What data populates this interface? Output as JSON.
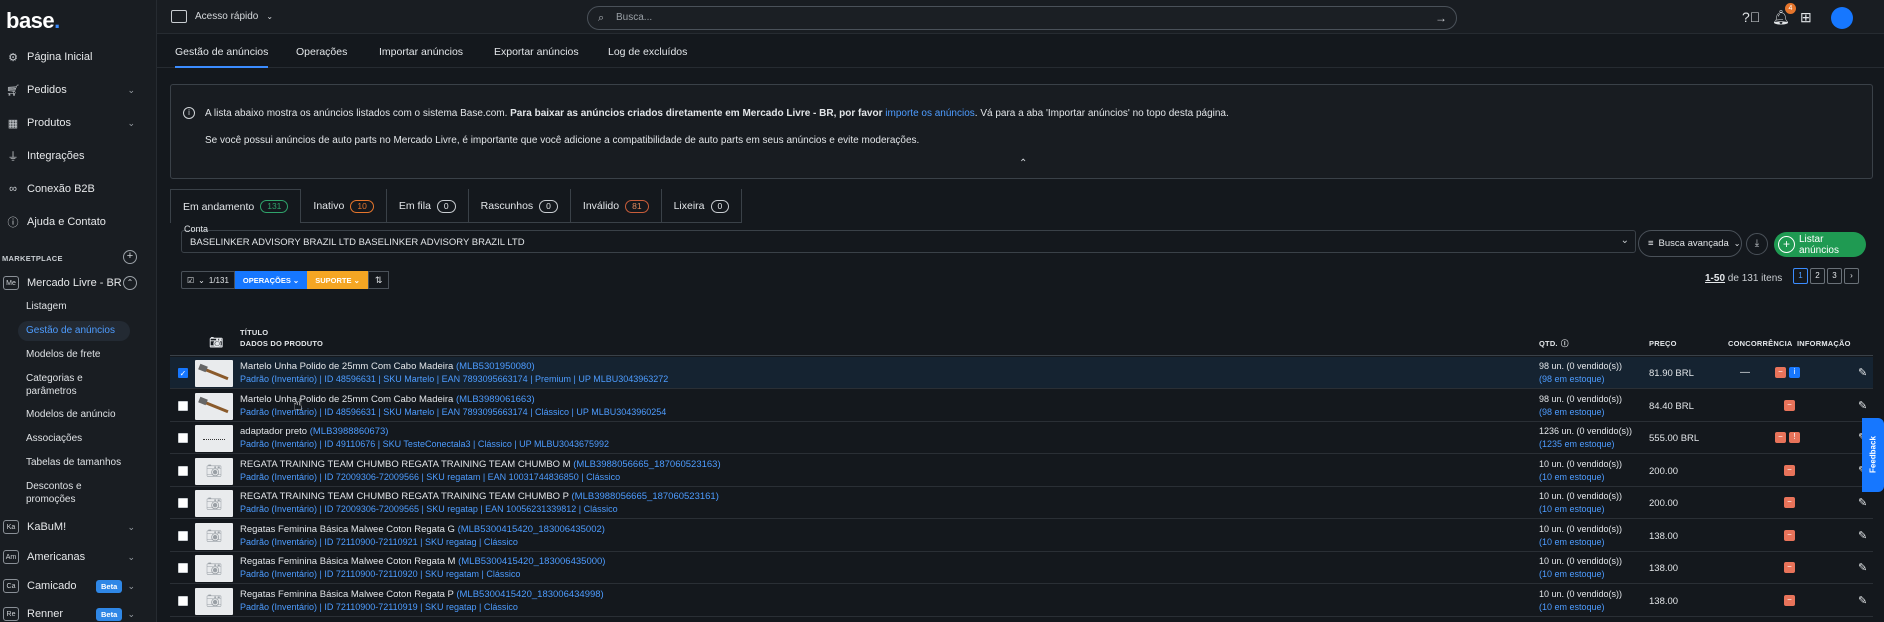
{
  "app": {
    "logo_text": "base",
    "logo_dot": "."
  },
  "sidebar": {
    "items": [
      {
        "label": "Página Inicial",
        "icon": "gear-icon"
      },
      {
        "label": "Pedidos",
        "icon": "cart-icon"
      },
      {
        "label": "Produtos",
        "icon": "box-icon"
      },
      {
        "label": "Integrações",
        "icon": "plug-icon"
      },
      {
        "label": "Conexão B2B",
        "icon": "link-icon"
      },
      {
        "label": "Ajuda e Contato",
        "icon": "help-icon"
      }
    ],
    "section_label": "MARKETPLACE",
    "marketplaces": [
      {
        "abbr": "Me",
        "label": "Mercado Livre - BR"
      },
      {
        "abbr": "Ka",
        "label": "KaBuM!"
      },
      {
        "abbr": "Am",
        "label": "Americanas"
      },
      {
        "abbr": "Ca",
        "label": "Camicado",
        "badge": "Beta"
      },
      {
        "abbr": "Re",
        "label": "Renner",
        "badge": "Beta"
      }
    ],
    "sub_items": [
      "Listagem",
      "Gestão de anúncios",
      "Modelos de frete",
      "Categorias e",
      "parâmetros",
      "Modelos de anúncio",
      "Associações",
      "Tabelas de tamanhos",
      "Descontos e",
      "promoções"
    ]
  },
  "topbar": {
    "quick_access": "Acesso rápido",
    "search_placeholder": "Busca...",
    "notif_count": "4"
  },
  "main_tabs": [
    "Gestão de anúncios",
    "Operações",
    "Importar anúncios",
    "Exportar anúncios",
    "Log de excluídos"
  ],
  "info": {
    "l1_a": "A lista abaixo mostra os anúncios listados com o sistema Base.com. ",
    "l1_b": "Para baixar as anúncios criados diretamente em Mercado Livre - BR, por favor ",
    "l1_link": "importe os anúncios",
    "l1_c": ". Vá para a aba 'Importar anúncios' no topo desta página.",
    "l2": "Se você possui anúncios de auto parts no Mercado Livre, é importante que você adicione a compatibilidade de auto parts em seus anúncios e evite moderações."
  },
  "status_tabs": [
    {
      "label": "Em andamento",
      "count": "131",
      "tone": "green"
    },
    {
      "label": "Inativo",
      "count": "10",
      "tone": "orange"
    },
    {
      "label": "Em fila",
      "count": "0",
      "tone": "plain"
    },
    {
      "label": "Rascunhos",
      "count": "0",
      "tone": "plain"
    },
    {
      "label": "Inválido",
      "count": "81",
      "tone": "red"
    },
    {
      "label": "Lixeira",
      "count": "0",
      "tone": "plain"
    }
  ],
  "conta": {
    "label": "Conta",
    "value": "BASELINKER ADVISORY BRAZIL LTD BASELINKER ADVISORY BRAZIL LTD"
  },
  "actions": {
    "busca": "Busca avançada",
    "listar": "Listar anúncios"
  },
  "toolbar": {
    "selected": "1/131",
    "ops": "OPERAÇÕES",
    "sup": "SUPORTE"
  },
  "pager": {
    "range": "1-50",
    "rest": " de 131 itens",
    "pages": [
      "1",
      "2",
      "3"
    ]
  },
  "table": {
    "headers": {
      "titulo": "TÍTULO",
      "dados": "DADOS DO PRODUTO",
      "qtd": "QTD.",
      "preco": "PREÇO",
      "concorrencia": "CONCORRÊNCIA",
      "informacao": "INFORMAÇÃO"
    },
    "rows": [
      {
        "title": "Martelo Unha Polido de 25mm Com Cabo Madeira ",
        "id": "(MLB5301950080)",
        "details": "Padrão (Inventário) | ID 48596631 | SKU Martelo | EAN 7893095663174 | Premium | UP MLBU3043963272",
        "qty": "98 un. (0 vendido(s))",
        "stock": "(98 em estoque)",
        "price": "81.90 BRL",
        "conc": "—",
        "thumb": "hammer",
        "checked": true,
        "blue": true
      },
      {
        "title": "Martelo Unha Polido de 25mm Com Cabo Madeira ",
        "id": "(MLB3989061663)",
        "details": "Padrão (Inventário) | ID 48596631 | SKU Martelo | EAN 7893095663174 | Clássico | UP MLBU3043960254",
        "qty": "98 un. (0 vendido(s))",
        "stock": "(98 em estoque)",
        "price": "84.40 BRL",
        "conc": "",
        "thumb": "hammer",
        "checked": false
      },
      {
        "title": "adaptador preto ",
        "id": "(MLB3988860673)",
        "details": "Padrão (Inventário) | ID 49110676 | SKU TesteConectala3 | Clássico | UP MLBU3043675992",
        "qty": "1236 un. (0 vendido(s))",
        "stock": "(1235 em estoque)",
        "price": "555.00 BRL",
        "conc": "",
        "thumb": "cable",
        "checked": false,
        "warn": true
      },
      {
        "title": "REGATA TRAINING TEAM CHUMBO REGATA TRAINING TEAM CHUMBO M ",
        "id": "(MLB3988056665_187060523163)",
        "details": "Padrão (Inventário) | ID 72009306-72009566 | SKU regatam | EAN 10031744836850 | Clássico",
        "qty": "10 un. (0 vendido(s))",
        "stock": "(10 em estoque)",
        "price": "200.00",
        "conc": "",
        "thumb": "cam",
        "checked": false
      },
      {
        "title": "REGATA TRAINING TEAM CHUMBO REGATA TRAINING TEAM CHUMBO P ",
        "id": "(MLB3988056665_187060523161)",
        "details": "Padrão (Inventário) | ID 72009306-72009565 | SKU regatap | EAN 10056231339812 | Clássico",
        "qty": "10 un. (0 vendido(s))",
        "stock": "(10 em estoque)",
        "price": "200.00",
        "conc": "",
        "thumb": "cam",
        "checked": false
      },
      {
        "title": "Regatas Feminina Básica Malwee Coton Regata G ",
        "id": "(MLB5300415420_183006435002)",
        "details": "Padrão (Inventário) | ID 72110900-72110921 | SKU regatag | Clássico",
        "qty": "10 un. (0 vendido(s))",
        "stock": "(10 em estoque)",
        "price": "138.00",
        "conc": "",
        "thumb": "cam",
        "checked": false
      },
      {
        "title": "Regatas Feminina Básica Malwee Coton Regata M ",
        "id": "(MLB5300415420_183006435000)",
        "details": "Padrão (Inventário) | ID 72110900-72110920 | SKU regatam | Clássico",
        "qty": "10 un. (0 vendido(s))",
        "stock": "(10 em estoque)",
        "price": "138.00",
        "conc": "",
        "thumb": "cam",
        "checked": false
      },
      {
        "title": "Regatas Feminina Básica Malwee Coton Regata P ",
        "id": "(MLB5300415420_183006434998)",
        "details": "Padrão (Inventário) | ID 72110900-72110919 | SKU regatap | Clássico",
        "qty": "10 un. (0 vendido(s))",
        "stock": "(10 em estoque)",
        "price": "138.00",
        "conc": "",
        "thumb": "cam",
        "checked": false
      }
    ]
  },
  "feedback": "Feedback"
}
